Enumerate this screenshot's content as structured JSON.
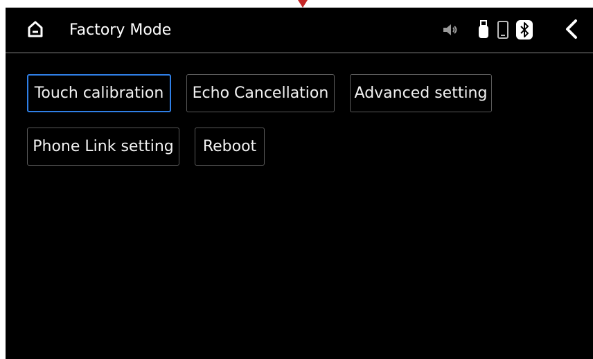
{
  "header": {
    "title": "Factory Mode",
    "home_icon": "home-icon",
    "back_icon": "chevron-left-icon"
  },
  "status_bar": {
    "icons": [
      "volume-icon",
      "usb-icon",
      "phone-icon",
      "bluetooth-icon"
    ]
  },
  "buttons": {
    "touch_calibration": "Touch calibration",
    "echo_cancellation": "Echo Cancellation",
    "advanced_setting": "Advanced setting",
    "phone_link_setting": "Phone Link setting",
    "reboot": "Reboot"
  },
  "colors": {
    "background": "#000000",
    "focus_border": "#2f7fe6",
    "button_border": "#5a5a5a",
    "text": "#ffffff",
    "marker": "#c62828"
  }
}
